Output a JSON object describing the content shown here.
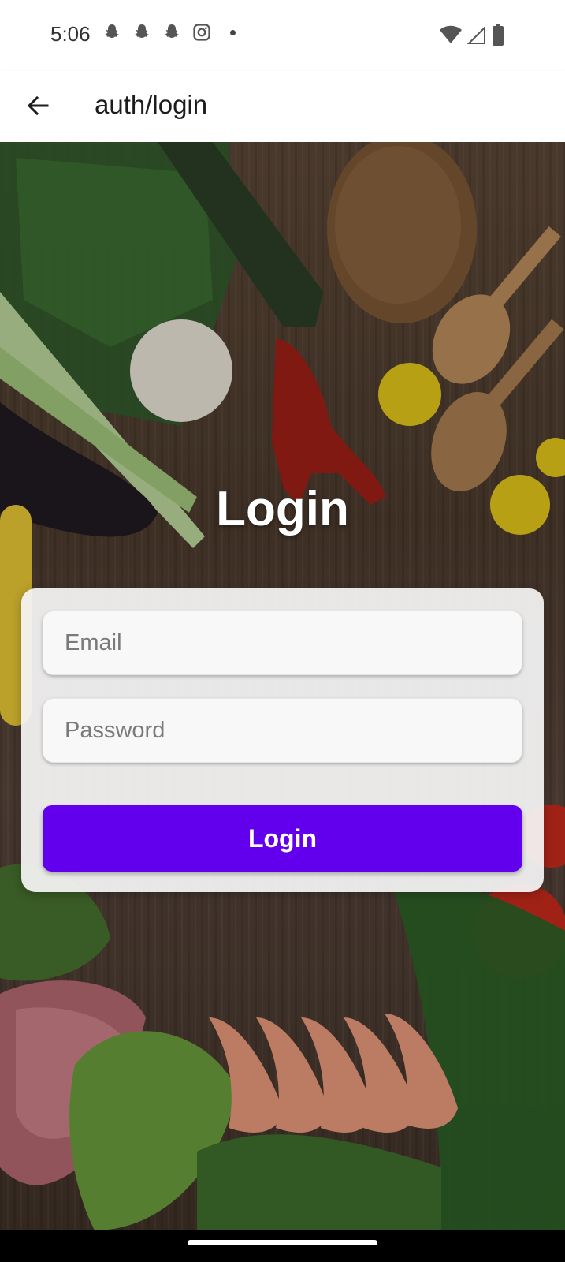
{
  "status_bar": {
    "time": "5:06",
    "left_icons": [
      "snapchat-icon",
      "snapchat-icon",
      "snapchat-icon",
      "instagram-icon"
    ],
    "right_icons": [
      "wifi-icon",
      "cell-signal-icon",
      "battery-icon"
    ]
  },
  "app_bar": {
    "back_icon": "arrow-left-icon",
    "title": "auth/login"
  },
  "login": {
    "heading": "Login",
    "email_placeholder": "Email",
    "password_placeholder": "Password",
    "button_label": "Login",
    "button_color": "#6200ee"
  }
}
